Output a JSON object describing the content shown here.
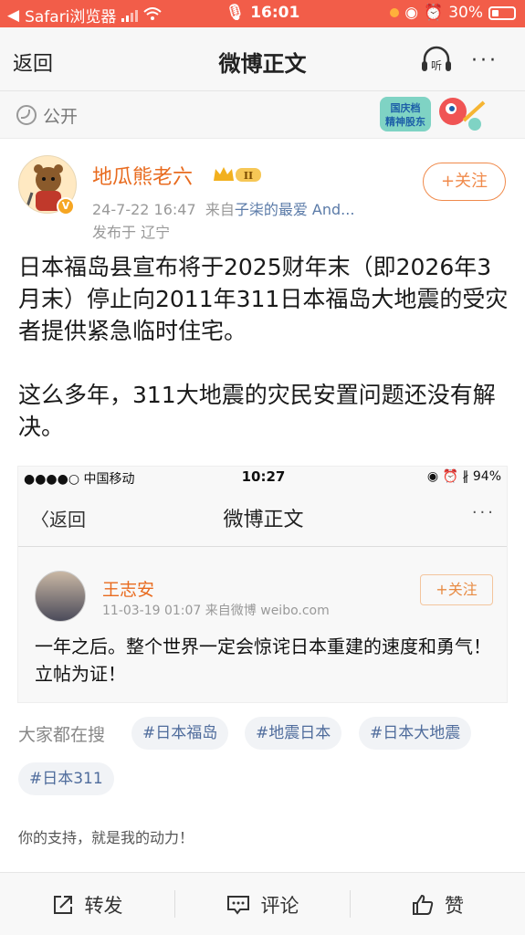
{
  "status_bar": {
    "carrier": "Safari浏览器",
    "time": "16:01",
    "battery": "30%"
  },
  "nav": {
    "back_label": "返回",
    "title": "微博正文",
    "listen_label": "听",
    "more_label": "···"
  },
  "visibility": {
    "icon": "globe-icon",
    "label": "公开",
    "banner_text": "国庆档 精神股东"
  },
  "author": {
    "name": "地瓜熊老六",
    "vip_level": "II",
    "verified_badge": "V",
    "time": "24-7-22 16:47",
    "source_prefix": "来自",
    "source": "子柒的最爱 And...",
    "location": "发布于 辽宁",
    "follow_label": "+关注"
  },
  "post": {
    "paragraph_1": "日本福岛县宣布将于2025财年末（即2026年3月末）停止向2011年311日本福岛大地震的受灾者提供紧急临时住宅。",
    "paragraph_2": "这么多年，311大地震的灾民安置问题还没有解决。"
  },
  "embedded": {
    "status_left": "●●●●○ 中国移动 ",
    "status_time": "10:27",
    "status_right": "◉ ⏰ ∦ 94%",
    "back_label": "〈返回",
    "title": "微博正文",
    "more_label": "···",
    "author_name": "王志安",
    "author_meta": "11-03-19 01:07  来自微博 weibo.com",
    "follow_label": "+关注",
    "text": "一年之后。整个世界一定会惊诧日本重建的速度和勇气！立帖为证！"
  },
  "search": {
    "label": "大家都在搜",
    "tags": [
      "#日本福岛",
      "#地震日本",
      "#日本大地震",
      "#日本311"
    ]
  },
  "support_text": "你的支持，就是我的动力！",
  "bottom_bar": {
    "repost_label": "转发",
    "comment_label": "评论",
    "like_label": "赞"
  },
  "colors": {
    "status_bar": "#f25d49",
    "accent_orange": "#e86b1f",
    "link_blue": "#5b7ba8",
    "tag_text": "#4f6c9c"
  }
}
